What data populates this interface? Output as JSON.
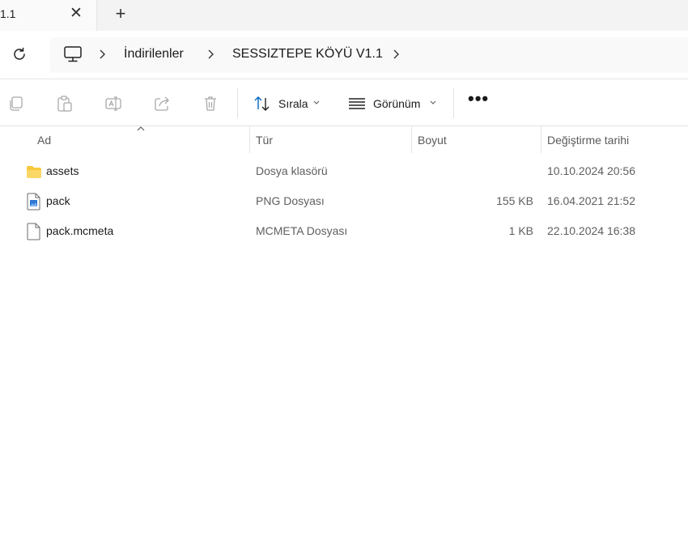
{
  "tabbar": {
    "tab_title": "1.1",
    "close_glyph": "✕",
    "add_glyph": "+"
  },
  "address": {
    "crumbs": [
      "İndirilenler",
      "SESSIZTEPE KÖYÜ V1.1"
    ],
    "icons": [
      "refresh-icon",
      "computer-icon",
      "chevron-right-icon"
    ]
  },
  "toolbar": {
    "sort_label": "Sırala",
    "view_label": "Görünüm",
    "more_glyph": "•••",
    "icons": [
      "copy-icon",
      "paste-icon",
      "rename-icon",
      "share-icon",
      "delete-icon",
      "sort-icon",
      "view-icon",
      "more-icon"
    ]
  },
  "columns": {
    "name": "Ad",
    "type": "Tür",
    "size": "Boyut",
    "modified": "Değiştirme tarihi"
  },
  "files": [
    {
      "name": "assets",
      "type": "Dosya klasörü",
      "size": "",
      "modified": "10.10.2024 20:56",
      "icon": "folder-icon"
    },
    {
      "name": "pack",
      "type": "PNG Dosyası",
      "size": "155 KB",
      "modified": "16.04.2021 21:52",
      "icon": "image-file-icon"
    },
    {
      "name": "pack.mcmeta",
      "type": "MCMETA Dosyası",
      "size": "1 KB",
      "modified": "22.10.2024 16:38",
      "icon": "file-icon"
    }
  ],
  "colors": {
    "accent": "#0067c0",
    "folder": "#f8c93d",
    "muted_text": "#5f5f5f"
  }
}
